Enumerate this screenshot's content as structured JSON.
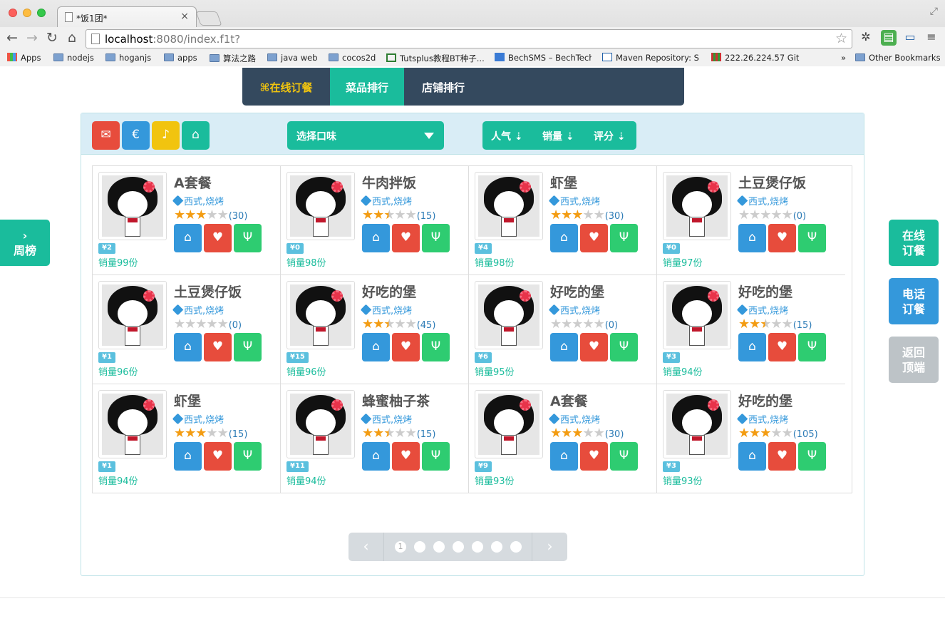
{
  "browser": {
    "tab_title": "*饭1团*",
    "tab_close": "×",
    "url_host": "localhost",
    "url_rest": ":8080/index.f1t?",
    "bookmarks": [
      {
        "label": "Apps",
        "icon": "apps-grid-icon"
      },
      {
        "label": "nodejs",
        "icon": "folder-icon"
      },
      {
        "label": "hoganjs",
        "icon": "folder-icon"
      },
      {
        "label": "apps",
        "icon": "folder-icon"
      },
      {
        "label": "算法之路",
        "icon": "folder-icon"
      },
      {
        "label": "java web",
        "icon": "folder-icon"
      },
      {
        "label": "cocos2d",
        "icon": "folder-icon"
      },
      {
        "label": "Tutsplus教程BT种子...",
        "icon": "page-icon"
      },
      {
        "label": "BechSMS – BechTech",
        "icon": "page-icon"
      },
      {
        "label": "Maven Repository: Se",
        "icon": "page-icon"
      },
      {
        "label": "222.26.224.57 Git",
        "icon": "page-icon"
      }
    ],
    "overflow": "»",
    "other_bookmarks": "Other Bookmarks"
  },
  "topnav": {
    "online": "⌘在线订餐",
    "dish_rank": "菜品排行",
    "shop_rank": "店铺排行"
  },
  "filters": {
    "taste_placeholder": "选择口味",
    "sort": [
      "人气 ⇣",
      "销量 ⇣",
      "评分 ⇣"
    ],
    "icon_buttons": [
      {
        "name": "gift-icon",
        "glyph": "✉",
        "color": "#e74c3c"
      },
      {
        "name": "euro-icon",
        "glyph": "€",
        "color": "#3498db"
      },
      {
        "name": "bell-icon",
        "glyph": "♪",
        "color": "#f1c40f"
      },
      {
        "name": "home-icon",
        "glyph": "⌂",
        "color": "#1abc9c"
      }
    ]
  },
  "tag_text": "西式,烧烤",
  "dishes": [
    {
      "name": "A套餐",
      "rating": 3,
      "count": "(30)",
      "price": "¥2",
      "sales": "销量99份"
    },
    {
      "name": "牛肉拌饭",
      "rating": 2.5,
      "count": "(15)",
      "price": "¥0",
      "sales": "销量98份"
    },
    {
      "name": "虾堡",
      "rating": 3,
      "count": "(30)",
      "price": "¥4",
      "sales": "销量98份"
    },
    {
      "name": "土豆煲仔饭",
      "rating": 0,
      "count": "(0)",
      "price": "¥0",
      "sales": "销量97份"
    },
    {
      "name": "土豆煲仔饭",
      "rating": 0,
      "count": "(0)",
      "price": "¥1",
      "sales": "销量96份"
    },
    {
      "name": "好吃的堡",
      "rating": 2.5,
      "count": "(45)",
      "price": "¥15",
      "sales": "销量96份"
    },
    {
      "name": "好吃的堡",
      "rating": 0,
      "count": "(0)",
      "price": "¥6",
      "sales": "销量95份"
    },
    {
      "name": "好吃的堡",
      "rating": 2.5,
      "count": "(15)",
      "price": "¥3",
      "sales": "销量94份"
    },
    {
      "name": "虾堡",
      "rating": 3,
      "count": "(15)",
      "price": "¥1",
      "sales": "销量94份"
    },
    {
      "name": "蜂蜜柚子茶",
      "rating": 2.5,
      "count": "(15)",
      "price": "¥11",
      "sales": "销量94份"
    },
    {
      "name": "A套餐",
      "rating": 3,
      "count": "(30)",
      "price": "¥9",
      "sales": "销量93份"
    },
    {
      "name": "好吃的堡",
      "rating": 3,
      "count": "(105)",
      "price": "¥3",
      "sales": "销量93份"
    }
  ],
  "pager": {
    "prev": "‹",
    "next": "›",
    "current": "1",
    "pages": 7
  },
  "side": {
    "weekly": "周榜",
    "online_order": "在线\n订餐",
    "phone_order": "电话\n订餐",
    "back_top": "返回\n顶端"
  }
}
